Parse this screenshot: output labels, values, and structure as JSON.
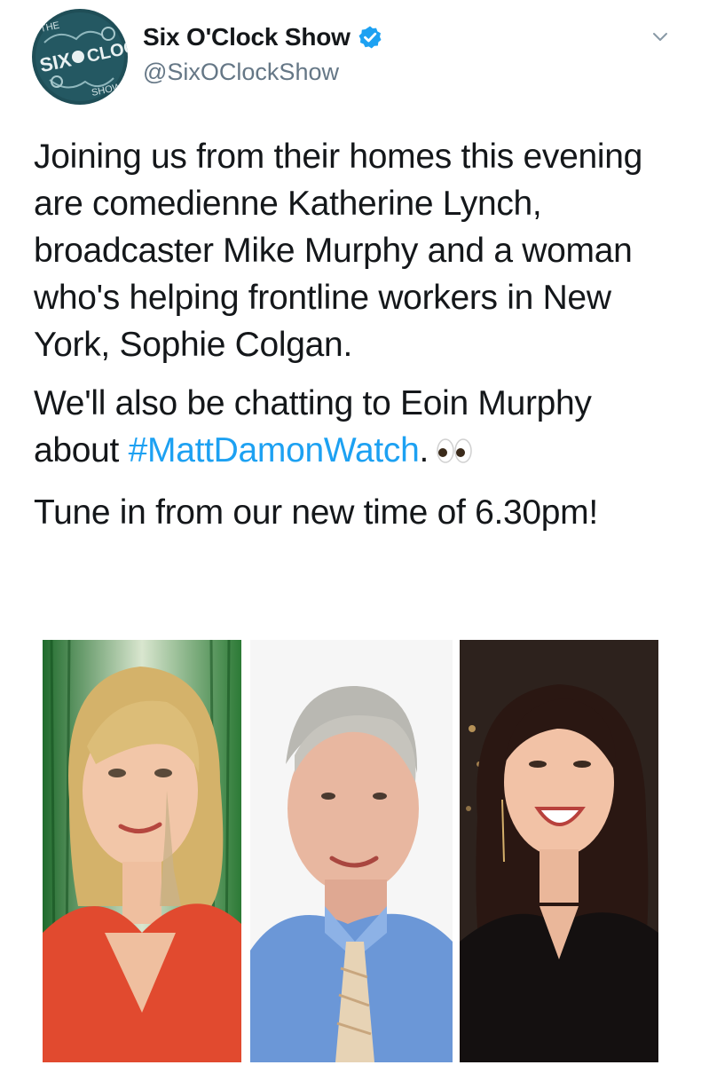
{
  "tweet": {
    "display_name": "Six O'Clock Show",
    "handle": "@SixOClockShow",
    "avatar": {
      "logo_text": [
        "THE",
        "SIX",
        "CLOCK",
        "SHOW"
      ]
    },
    "body": {
      "p1": "Joining us from their homes this evening are comedienne Katherine Lynch, broadcaster Mike Murphy and a woman who's helping frontline workers in New York, Sophie Colgan.",
      "p2_before": "We'll also be chatting to Eoin Murphy about ",
      "p2_hashtag": "#MattDamonWatch",
      "p2_after": ".",
      "p3": "Tune in from our new time of 6.30pm!"
    },
    "icons": [
      "verified-badge-icon",
      "chevron-down-icon",
      "eyes-emoji-icon"
    ],
    "colors": {
      "link": "#1da1f2",
      "verified": "#1da1f2",
      "secondary_text": "#657786",
      "text": "#14171a"
    }
  }
}
